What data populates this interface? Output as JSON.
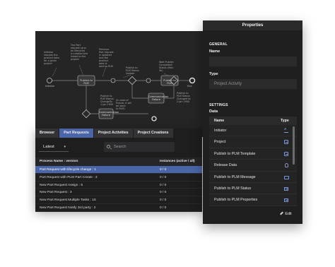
{
  "diagram": {
    "notes": [
      "Initiator\nrequest the\nproduct data\nfor a given\nproject",
      "The Part\nrequest (and\nits lifecycle)\nis created and\nlinked to the\nproject",
      "Previous\nPart request\nis updated\nand the\nproduct\ndata is\nsent to PLM",
      "Publish to PLM\nTemplate",
      "Wait Publish\nCompleted\nStatus (Max\n3h)",
      "Wait Publish\nCompleted\nStatus (Max\n3h)",
      "Publish to\nPLM Status\nChangeTo\n1 Jan 1900",
      "Publish to\nPLM Status\nChanged to\n2 Jan 1900",
      "Publish to\nPLM Status\nUpdate",
      "(In case of\nFailure, it will\nbe send\nto PLM)"
    ],
    "tasks": [
      "Publish to PLM",
      "Publish to PLM",
      "Communication\nFailure",
      "Communication\nFailure"
    ],
    "start_label": "Initiator",
    "end_label": "End"
  },
  "bottom_panel": {
    "tabs": [
      {
        "label": "Browser"
      },
      {
        "label": "Part Requests"
      },
      {
        "label": "Project Activities"
      },
      {
        "label": "Project Creations"
      }
    ],
    "active_tab": "Part Requests",
    "version_select": "Latest",
    "search_placeholder": "Search",
    "columns": [
      "Process Name : version",
      "Instances (active / all)"
    ],
    "rows": [
      {
        "name": "Part Request with lifecycle change : 1",
        "instances": "0 / 0"
      },
      {
        "name": "Part Request with PLM Part Create : 3",
        "instances": "0 / 0"
      },
      {
        "name": "New Part Request Assign : 6",
        "instances": "0 / 0"
      },
      {
        "name": "New Part Request : 3",
        "instances": "0 / 0"
      },
      {
        "name": "New Part Request Multiple Tasks : 15",
        "instances": "0 / 0"
      },
      {
        "name": "New Part Request Notify 3rd party : 2",
        "instances": "0 / 0"
      }
    ],
    "selected_row": 0
  },
  "properties": {
    "title": "Properties",
    "general_heading": "GENERAL",
    "name_label": "Name",
    "name_value": "",
    "type_label": "Type",
    "type_value": "Project Activity",
    "settings_heading": "SETTINGS",
    "data_label": "Data",
    "data_columns": [
      "Name",
      "Type"
    ],
    "data_rows": [
      {
        "name": "Initiator",
        "type_icon": "text-type-icon"
      },
      {
        "name": "Project",
        "type_icon": "document-icon"
      },
      {
        "name": "Publish to PLM Template",
        "type_icon": "document-icon"
      },
      {
        "name": "Release Data",
        "type_icon": "database-icon"
      },
      {
        "name": "Publish to PLM Message",
        "type_icon": "message-icon"
      },
      {
        "name": "Publish to PLM Status",
        "type_icon": "list-icon"
      },
      {
        "name": "Publish to PLM Properties",
        "type_icon": "list-icon"
      }
    ],
    "edit_label": "Edit"
  },
  "colors": {
    "accent": "#4a66a8",
    "panel_bg": "#1f1f1f",
    "canvas_bg": "#252526"
  }
}
